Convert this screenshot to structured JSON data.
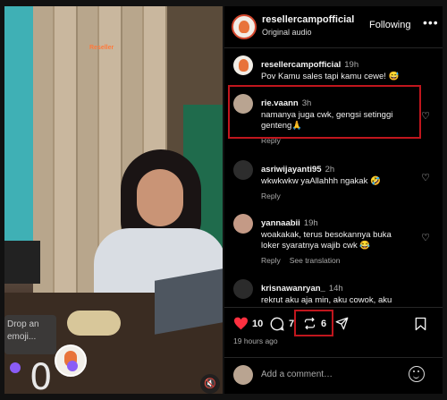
{
  "video": {
    "watermark": "Reseller",
    "emoji_prompt": "Drop an emoji...",
    "overlay_count": "0"
  },
  "header": {
    "username": "resellercampofficial",
    "subtitle": "Original audio",
    "follow_label": "Following",
    "more_label": "•••"
  },
  "comments": [
    {
      "user": "resellercampofficial",
      "time": "19h",
      "text": "Pov Kamu sales tapi kamu cewe! 😅",
      "reply": "",
      "see_translation": ""
    },
    {
      "user": "rie.vaann",
      "time": "3h",
      "text": "namanya juga cwk, gengsi setinggi genteng🙏",
      "reply": "Reply",
      "see_translation": ""
    },
    {
      "user": "asriwijayanti95",
      "time": "2h",
      "text": "wkwkwkw yaAllahhh ngakak 🤣",
      "reply": "Reply",
      "see_translation": ""
    },
    {
      "user": "yannaabii",
      "time": "19h",
      "text": "woakakak, terus besokannya buka loker syaratnya wajib cwk 😂",
      "reply": "Reply",
      "see_translation": "See translation"
    },
    {
      "user": "krisnawanryan_",
      "time": "14h",
      "text": "rekrut aku aja min, aku cowok, aku",
      "reply": "",
      "see_translation": ""
    }
  ],
  "actions": {
    "likes": "10",
    "comments": "7",
    "reposts": "6",
    "time_ago": "19 hours ago"
  },
  "add_comment": {
    "placeholder": "Add a comment…"
  },
  "colors": {
    "highlight": "#c0161d",
    "like_red": "#ff3040"
  }
}
